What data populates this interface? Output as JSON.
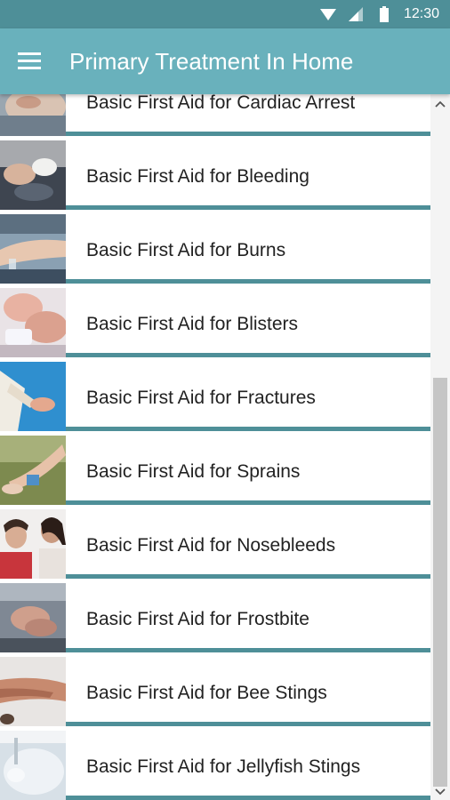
{
  "status": {
    "time": "12:30"
  },
  "appbar": {
    "title": "Primary Treatment In Home"
  },
  "items": [
    {
      "label": "Basic First Aid for Cardiac Arrest",
      "thumb": "cardiac"
    },
    {
      "label": "Basic First Aid for Bleeding",
      "thumb": "bleeding"
    },
    {
      "label": "Basic First Aid for Burns",
      "thumb": "burns"
    },
    {
      "label": "Basic First Aid for Blisters",
      "thumb": "blisters"
    },
    {
      "label": "Basic First Aid for Fractures",
      "thumb": "fractures"
    },
    {
      "label": "Basic First Aid for Sprains",
      "thumb": "sprains"
    },
    {
      "label": "Basic First Aid for Nosebleeds",
      "thumb": "nosebleeds"
    },
    {
      "label": "Basic First Aid for Frostbite",
      "thumb": "frostbite"
    },
    {
      "label": "Basic First Aid for Bee Stings",
      "thumb": "bee"
    },
    {
      "label": "Basic First Aid for Jellyfish Stings",
      "thumb": "jellyfish"
    }
  ],
  "colors": {
    "appbar": "#69b1bc",
    "statusbar": "#4e8f98",
    "divider": "#4e8f98"
  }
}
